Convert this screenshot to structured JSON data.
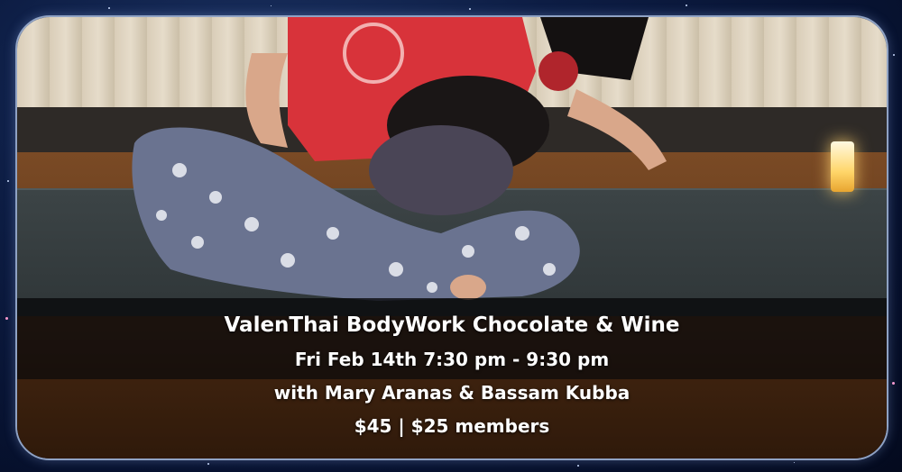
{
  "event": {
    "title": "ValenThai BodyWork Chocolate & Wine",
    "datetime": "Fri Feb 14th 7:30 pm - 9:30 pm",
    "hosts": "with Mary Aranas & Bassam Kubba",
    "price": "$45 | $25 members"
  },
  "colors": {
    "background": "#0a1638",
    "frame_border": "#8fa2c4",
    "text": "#ffffff",
    "shirt": "#d8333a",
    "pants": "#6a7390"
  }
}
